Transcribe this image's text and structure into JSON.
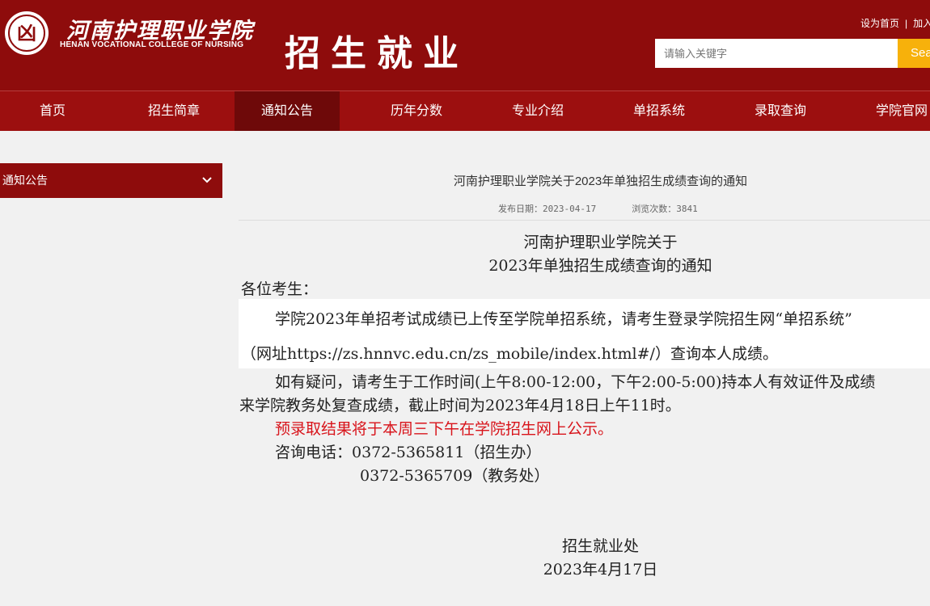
{
  "header": {
    "college_name_cn": "河南护理职业学院",
    "college_name_en": "HENAN VOCATIONAL COLLEGE OF NURSING",
    "site_title": "招生就业",
    "top_links": [
      "设为首页",
      "加入收藏"
    ],
    "search_placeholder": "请输入关键字",
    "search_button": "Search"
  },
  "nav": {
    "items": [
      "首页",
      "招生简章",
      "通知公告",
      "历年分数",
      "专业介绍",
      "单招系统",
      "录取查询",
      "学院官网"
    ],
    "active_index": 2
  },
  "sidebar": {
    "title": "通知公告"
  },
  "article": {
    "title": "河南护理职业学院关于2023年单独招生成绩查询的通知",
    "publish_label": "发布日期：2023-04-17",
    "views_label": "浏览次数：3841",
    "content_title_line1": "河南护理职业学院关于",
    "content_title_line2": "2023年单独招生成绩查询的通知",
    "greeting": "各位考生：",
    "para1_line1": "学院2023年单招考试成绩已上传至学院单招系统，请考生登录学院招生网“单招系统”",
    "para1_line2": "（网址https://zs.hnnvc.edu.cn/zs_mobile/index.html#/）查询本人成绩。",
    "para2_line1": "如有疑问，请考生于工作时间(上午8:00-12:00，下午2:00-5:00)持本人有效证件及成绩",
    "para2_line2": "来学院教务处复查成绩，截止时间为2023年4月18日上午11时。",
    "red_notice": "预录取结果将于本周三下午在学院招生网上公示。",
    "phone_line1": "咨询电话：0372-5365811（招生办）",
    "phone_line2": "0372-5365709（教务处）",
    "signature": "招生就业处",
    "date": "2023年4月17日"
  },
  "colors": {
    "brand_red": "#8e0c0c",
    "nav_red": "#9c0f0f",
    "nav_active": "#6e0909",
    "search_yellow": "#f7b10b",
    "notice_red": "#d8141b"
  }
}
